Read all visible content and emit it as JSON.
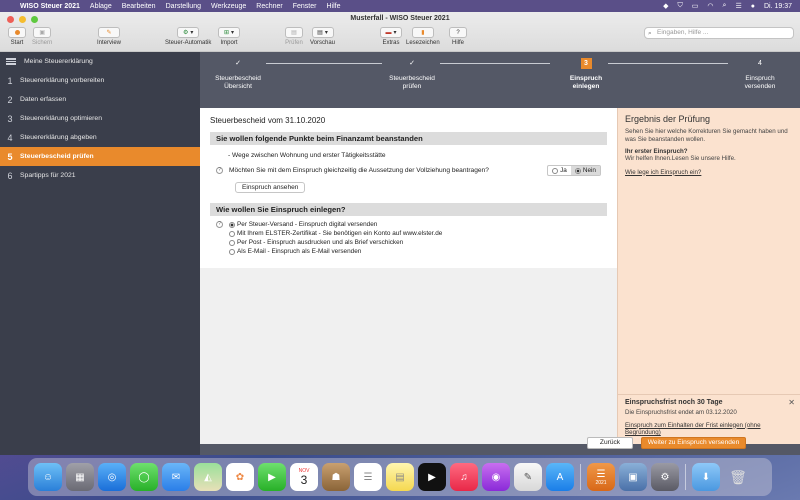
{
  "menubar": {
    "app_name": "WISO Steuer 2021",
    "items": [
      "Ablage",
      "Bearbeiten",
      "Darstellung",
      "Werkzeuge",
      "Rechner",
      "Fenster",
      "Hilfe"
    ],
    "clock": "Di. 19:37"
  },
  "window": {
    "title": "Musterfall - WISO Steuer 2021"
  },
  "toolbar": {
    "start": "Start",
    "sichern": "Sichern",
    "interview": "Interview",
    "steuer_automatik": "Steuer-Automatik",
    "import": "Import",
    "pruefen": "Prüfen",
    "vorschau": "Vorschau",
    "extras": "Extras",
    "lesezeichen": "Lesezeichen",
    "hilfe": "Hilfe",
    "search_placeholder": "Eingaben, Hilfe ..."
  },
  "sidebar": {
    "header": "Meine Steuererklärung",
    "items": [
      {
        "num": "1",
        "label": "Steuererklärung vorbereiten"
      },
      {
        "num": "2",
        "label": "Daten erfassen"
      },
      {
        "num": "3",
        "label": "Steuererklärung optimieren"
      },
      {
        "num": "4",
        "label": "Steuererklärung abgeben"
      },
      {
        "num": "5",
        "label": "Steuerbescheid prüfen"
      },
      {
        "num": "6",
        "label": "Spartipps für 2021"
      }
    ],
    "active_index": 4
  },
  "stepper": {
    "steps": [
      {
        "mark": "✓",
        "label1": "Steuerbescheid",
        "label2": "Übersicht",
        "state": "done"
      },
      {
        "mark": "✓",
        "label1": "Steuerbescheid",
        "label2": "prüfen",
        "state": "done"
      },
      {
        "mark": "3",
        "label1": "Einspruch",
        "label2": "einlegen",
        "state": "current"
      },
      {
        "mark": "4",
        "label1": "Einspruch",
        "label2": "versenden",
        "state": "todo"
      }
    ]
  },
  "main": {
    "bescheid_title": "Steuerbescheid vom 31.10.2020",
    "section1_title": "Sie wollen folgende Punkte beim Finanzamt beanstanden",
    "point": "- Wege zwischen Wohnung und erster Tätigkeitsstätte",
    "question": "Möchten Sie mit dem Einspruch gleichzeitig die Aussetzung der Vollziehung beantragen?",
    "ja": "Ja",
    "nein": "Nein",
    "selected_answer": "Nein",
    "view_button": "Einspruch ansehen",
    "section2_title": "Wie wollen Sie Einspruch einlegen?",
    "options": [
      "Per Steuer-Versand - Einspruch digital versenden",
      "Mit Ihrem ELSTER-Zertifikat - Sie benötigen ein Konto auf www.elster.de",
      "Per Post - Einspruch ausdrucken und als Brief verschicken",
      "Als E-Mail - Einspruch als E-Mail versenden"
    ],
    "selected_option": 0
  },
  "right_panel": {
    "title": "Ergebnis der Prüfung",
    "text": "Sehen Sie hier welche Korrekturen Sie gemacht haben und was Sie beanstanden wollen.",
    "strong": "Ihr erster Einspruch?",
    "strong_text": "Wir helfen Ihnen.Lesen Sie unsere Hilfe.",
    "link": "Wie lege ich Einspruch ein?",
    "deadline_title": "Einspruchsfrist noch 30 Tage",
    "deadline_text": "Die Einspruchsfrist endet am 03.12.2020",
    "deadline_link": "Einspruch zum Einhalten der Frist einlegen (ohne Begründung)"
  },
  "footer": {
    "back": "Zurück",
    "next": "Weiter zu Einspruch versenden"
  },
  "dock": {
    "calendar_month": "NOV",
    "calendar_day": "3",
    "wiso_label": "2021"
  },
  "colors": {
    "accent": "#e98a2c",
    "sidebar_bg": "#3a3e4b",
    "stepper_bg": "#545866",
    "right_panel_bg": "#fbe2cf"
  }
}
